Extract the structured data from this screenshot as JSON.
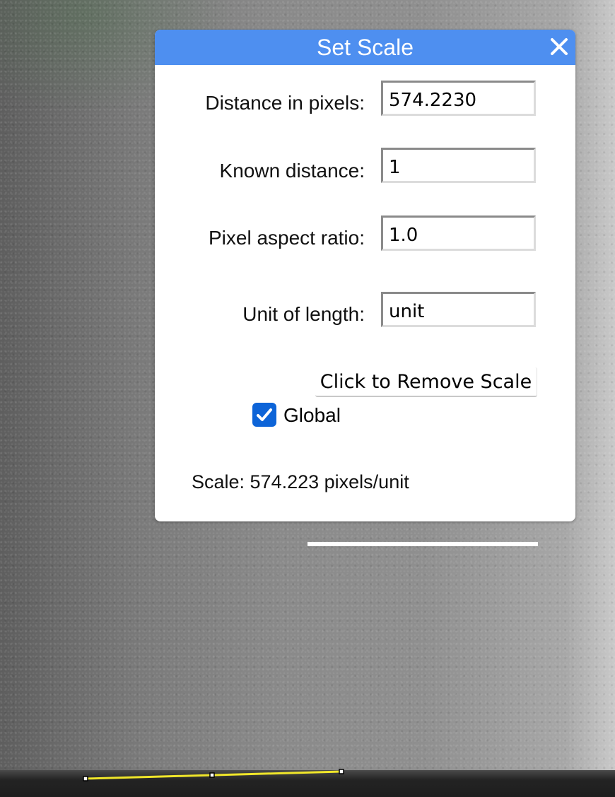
{
  "dialog": {
    "title": "Set Scale",
    "close_icon": "close-icon",
    "fields": [
      {
        "label": "Distance in pixels:",
        "value": "574.2230"
      },
      {
        "label": "Known distance:",
        "value": "1"
      },
      {
        "label": "Pixel aspect ratio:",
        "value": "1.0"
      },
      {
        "label": "Unit of length:",
        "value": "unit"
      }
    ],
    "remove_button": "Click to Remove Scale",
    "global": {
      "label": "Global",
      "checked": true
    },
    "scale_text": "Scale: 574.223 pixels/unit"
  },
  "colors": {
    "titlebar": "#4e8ff0",
    "checkbox": "#0d64d8",
    "measure_line": "#f0e62a",
    "scale_bar": "#ffffff"
  }
}
